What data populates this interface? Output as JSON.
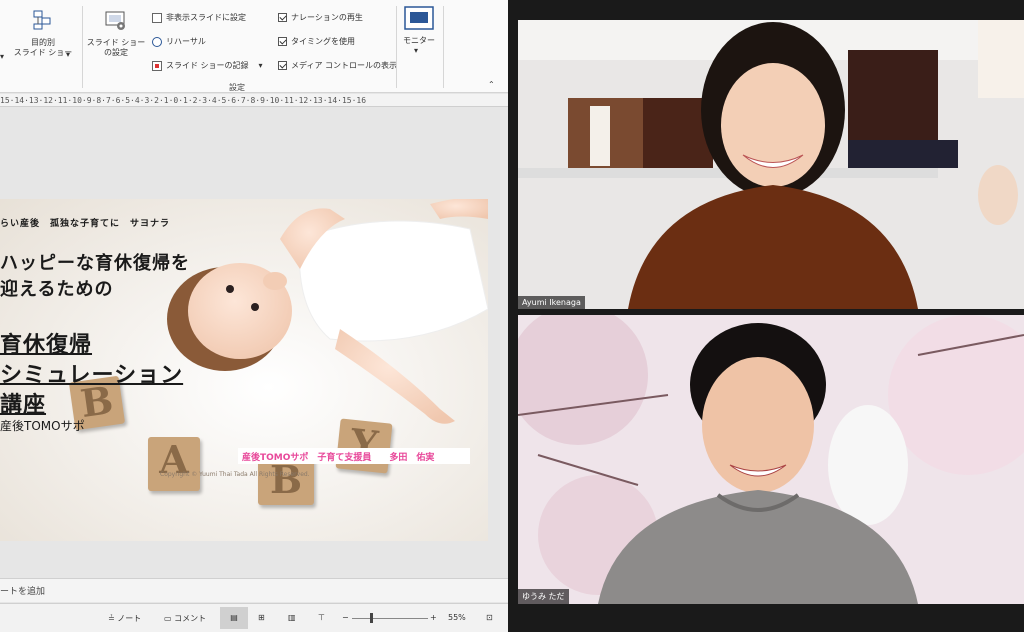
{
  "ribbon": {
    "custom_show_label": "目的別\nスライド ショー",
    "setup_show_label": "スライド ショー\nの設定",
    "hide_slide_label": "非表示スライドに設定",
    "rehearse_label": "リハーサル",
    "record_label": "スライド ショーの記録",
    "play_narration_label": "ナレーションの再生",
    "use_timings_label": "タイミングを使用",
    "show_media_controls_label": "メディア コントロールの表示",
    "monitor_label": "モニター",
    "group_label": "設定"
  },
  "ruler": {
    "text": "15·14·13·12·11·10·9·8·7·6·5·4·3·2·1·0·1·2·3·4·5·6·7·8·9·10·11·12·13·14·15·16"
  },
  "slide": {
    "tagline": "らい産後　孤独な子育てに　サヨナラ",
    "headline1": "ハッピーな育休復帰を",
    "headline2": "迎えるための",
    "title1": "育休復帰",
    "title2": "シミュレーション",
    "title3": "講座",
    "org": "産後TOMOサポ",
    "presenter": "産後TOMOサポ　子育て支援員　　多田　佑実",
    "copyright": "Copyright © Yuumi Thai Tada All Rights Reserved.",
    "blocks": [
      "B",
      "A",
      "B",
      "Y"
    ]
  },
  "notes": {
    "placeholder": "ートを追加"
  },
  "status": {
    "notes_label": "ノート",
    "comments_label": "コメント",
    "zoom": "55%"
  },
  "participants": [
    {
      "name": "Ayumi Ikenaga"
    },
    {
      "name": "ゆうみ ただ"
    }
  ],
  "colors": {
    "accent_pink": "#e8489a",
    "monitor_blue": "#2b5797"
  }
}
